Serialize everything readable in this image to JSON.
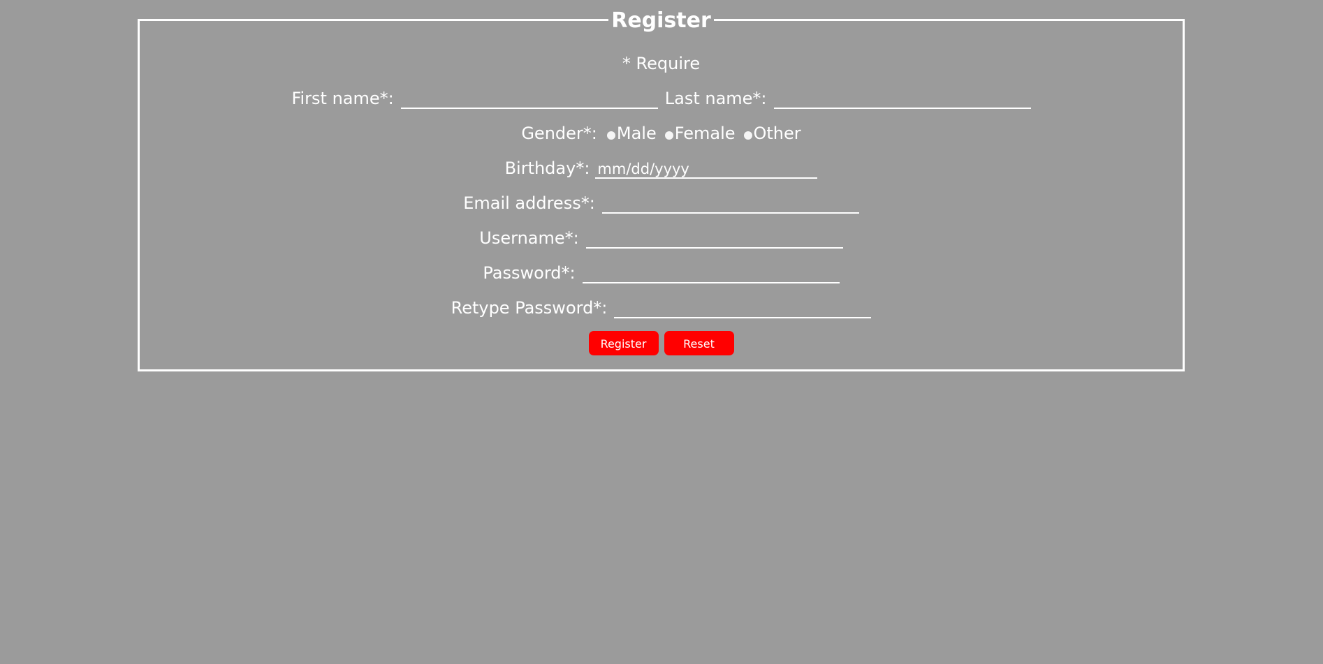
{
  "form": {
    "legend": "Register",
    "required_note": "* Require",
    "first_name_label": "First name*:",
    "last_name_label": "Last name*:",
    "gender_label": "Gender*:",
    "gender_options": [
      "Male",
      "Female",
      "Other"
    ],
    "birthday_label": "Birthday*:",
    "birthday_placeholder": "mm/dd/yyyy",
    "email_label": "Email address*:",
    "username_label": "Username*:",
    "password_label": "Password*:",
    "retype_password_label": "Retype Password*:",
    "register_button": "Register",
    "reset_button": "Reset"
  },
  "colors": {
    "background": "#9b9b9b",
    "text": "#ffffff",
    "button": "#ff0000"
  }
}
